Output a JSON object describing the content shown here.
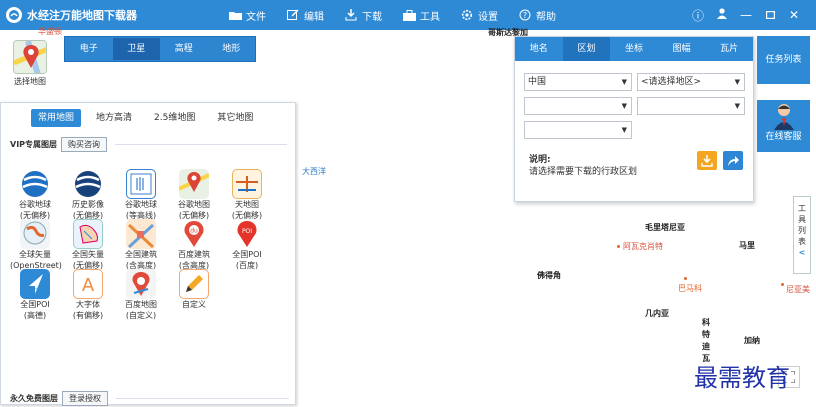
{
  "app": {
    "title": "水经注万能地图下载器"
  },
  "menu": [
    {
      "label": "文件",
      "icon": "folder-icon"
    },
    {
      "label": "编辑",
      "icon": "edit-icon"
    },
    {
      "label": "下载",
      "icon": "download-icon"
    },
    {
      "label": "工具",
      "icon": "toolbox-icon"
    },
    {
      "label": "设置",
      "icon": "gear-icon"
    },
    {
      "label": "帮助",
      "icon": "help-icon"
    }
  ],
  "window_controls": [
    "ⓘ",
    "👤",
    "—",
    "▢",
    "✕"
  ],
  "map_selector": {
    "label": "选择地图"
  },
  "map_types": [
    {
      "label": "电子",
      "active": false
    },
    {
      "label": "卫星",
      "active": true
    },
    {
      "label": "高程",
      "active": false
    },
    {
      "label": "地形",
      "active": false
    }
  ],
  "source_panel": {
    "tabs": [
      {
        "label": "常用地图",
        "active": true
      },
      {
        "label": "地方高清",
        "active": false
      },
      {
        "label": "2.5维地图",
        "active": false
      },
      {
        "label": "其它地图",
        "active": false
      }
    ],
    "vip": {
      "title": "VIP专属图层",
      "button": "购买咨询"
    },
    "free": {
      "title": "永久免费图层",
      "button": "登录授权"
    },
    "items": [
      {
        "l1": "谷歌地球",
        "l2": "(无偏移)",
        "icon": "google-earth-icon"
      },
      {
        "l1": "历史影像",
        "l2": "(无偏移)",
        "icon": "history-imagery-icon"
      },
      {
        "l1": "谷歌地球",
        "l2": "(等高线)",
        "icon": "contour-icon"
      },
      {
        "l1": "谷歌地图",
        "l2": "(无偏移)",
        "icon": "google-maps-icon"
      },
      {
        "l1": "天地图",
        "l2": "(无偏移)",
        "icon": "tianditu-icon"
      },
      {
        "l1": "全球矢量",
        "l2": "(OpenStreet)",
        "icon": "openstreet-icon"
      },
      {
        "l1": "全国矢量",
        "l2": "(无偏移)",
        "icon": "vector-map-icon"
      },
      {
        "l1": "全国建筑",
        "l2": "(含高度)",
        "icon": "buildings-icon"
      },
      {
        "l1": "百度建筑",
        "l2": "(含高度)",
        "icon": "baidu-pin-icon"
      },
      {
        "l1": "全国POI",
        "l2": "(百度)",
        "icon": "poi-baidu-icon"
      },
      {
        "l1": "全国POI",
        "l2": "(高德)",
        "icon": "poi-gaode-icon"
      },
      {
        "l1": "大字体",
        "l2": "(有偏移)",
        "icon": "large-font-icon"
      },
      {
        "l1": "百度地图",
        "l2": "(自定义)",
        "icon": "baidu-map-icon"
      },
      {
        "l1": "自定义",
        "l2": "",
        "icon": "pencil-icon"
      }
    ]
  },
  "region_panel": {
    "tabs": [
      {
        "label": "地名",
        "active": false
      },
      {
        "label": "区划",
        "active": true
      },
      {
        "label": "坐标",
        "active": false
      },
      {
        "label": "图幅",
        "active": false
      },
      {
        "label": "瓦片",
        "active": false
      }
    ],
    "country": "中国",
    "region_placeholder": "<请选择地区>",
    "note_title": "说明:",
    "note": "请选择需要下载的行政区划"
  },
  "side_buttons": {
    "tasks": "任务列表",
    "service": "在线客服"
  },
  "tool_sidebar": {
    "label": "工具列表",
    "chars": [
      "工",
      "具",
      "列",
      "表"
    ],
    "arrow": "<"
  },
  "map_labels": [
    {
      "text": "华盛顿",
      "cls": "red"
    },
    {
      "text": "哥斯达黎加",
      "cls": ""
    },
    {
      "text": "大西洋",
      "cls": "blue"
    },
    {
      "text": "毛里塔尼亚",
      "cls": ""
    },
    {
      "text": "阿瓦克肖特",
      "cls": "red"
    },
    {
      "text": "马里",
      "cls": ""
    },
    {
      "text": "佛得角",
      "cls": ""
    },
    {
      "text": "巴马科",
      "cls": "orange"
    },
    {
      "text": "尼亚美",
      "cls": "red"
    },
    {
      "text": "几内亚",
      "cls": ""
    },
    {
      "text": "科特迪瓦",
      "cls": ""
    },
    {
      "text": "加纳",
      "cls": ""
    }
  ],
  "watermark": "最需教育",
  "colors": {
    "titlebar": "#2f8ad6",
    "accent": "#2f8ad6",
    "download_btn": "#f4a623",
    "locate_btn": "#2e86d4"
  }
}
